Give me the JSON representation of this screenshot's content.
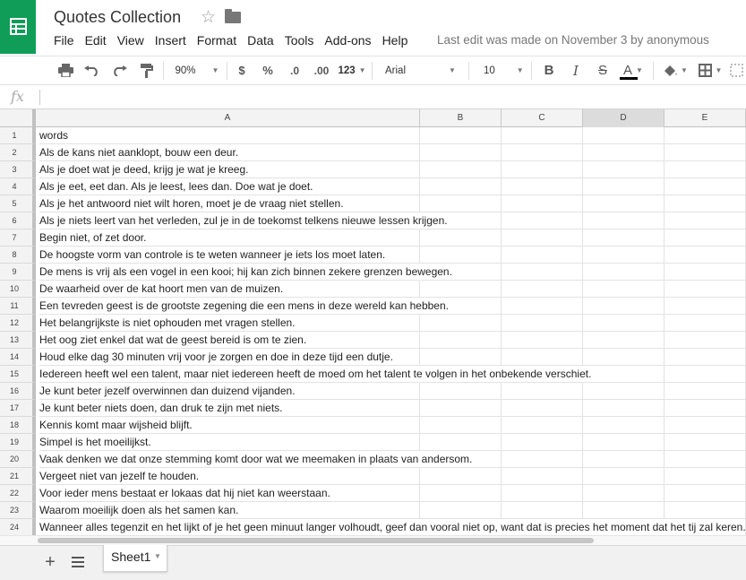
{
  "app": {
    "title": "Quotes Collection",
    "last_edit": "Last edit was made on November 3 by anonymous",
    "brand_color": "#0f9d58"
  },
  "menu": [
    "File",
    "Edit",
    "View",
    "Insert",
    "Format",
    "Data",
    "Tools",
    "Add-ons",
    "Help"
  ],
  "toolbar": {
    "zoom": "90%",
    "currency": "$",
    "percent": "%",
    "decrease_decimals": ".0",
    "increase_decimals": ".00",
    "more_formats": "123",
    "font": "Arial",
    "font_size": "10",
    "bold": "B",
    "italic": "I",
    "strikethrough": "S",
    "text_color_letter": "A",
    "text_color": "#000000",
    "icons": [
      "print-icon",
      "undo-icon",
      "redo-icon",
      "paint-format-icon",
      "fill-color-icon",
      "borders-icon",
      "merge-cells-icon"
    ]
  },
  "formula_bar": {
    "fx": "fx",
    "value": ""
  },
  "columns": [
    "A",
    "B",
    "C",
    "D",
    "E"
  ],
  "selected_column": "D",
  "rows": [
    {
      "n": "1",
      "a": "words"
    },
    {
      "n": "2",
      "a": "Als de kans niet aanklopt, bouw een deur."
    },
    {
      "n": "3",
      "a": "Als je doet wat je deed, krijg je wat je kreeg."
    },
    {
      "n": "4",
      "a": "Als je eet, eet dan. Als je leest, lees dan. Doe wat je doet."
    },
    {
      "n": "5",
      "a": "Als je het antwoord niet wilt horen, moet je de vraag niet stellen."
    },
    {
      "n": "6",
      "a": "Als je niets leert van het verleden, zul je in de toekomst telkens nieuwe lessen krijgen."
    },
    {
      "n": "7",
      "a": "Begin niet, of zet door."
    },
    {
      "n": "8",
      "a": "De hoogste vorm van controle is te weten wanneer je iets los moet laten."
    },
    {
      "n": "9",
      "a": "De mens is vrij als een vogel in een kooi; hij kan zich binnen zekere grenzen bewegen."
    },
    {
      "n": "10",
      "a": "De waarheid over de kat hoort men van de muizen."
    },
    {
      "n": "11",
      "a": "Een tevreden geest is de grootste zegening die een mens in deze wereld kan hebben."
    },
    {
      "n": "12",
      "a": "Het belangrijkste is niet ophouden met vragen stellen."
    },
    {
      "n": "13",
      "a": "Het oog ziet enkel dat wat de geest bereid is om te zien."
    },
    {
      "n": "14",
      "a": "Houd elke dag 30 minuten vrij voor je zorgen en doe in deze tijd een dutje."
    },
    {
      "n": "15",
      "a": "Iedereen heeft wel een talent, maar niet iedereen heeft de moed om het talent te volgen in het onbekende verschiet."
    },
    {
      "n": "16",
      "a": "Je kunt beter jezelf overwinnen dan duizend vijanden."
    },
    {
      "n": "17",
      "a": "Je kunt beter niets doen, dan druk te zijn met niets."
    },
    {
      "n": "18",
      "a": "Kennis komt maar wijsheid blijft."
    },
    {
      "n": "19",
      "a": "Simpel is het moeilijkst."
    },
    {
      "n": "20",
      "a": "Vaak denken we dat onze stemming komt door wat we meemaken in plaats van andersom."
    },
    {
      "n": "21",
      "a": "Vergeet niet van jezelf te houden."
    },
    {
      "n": "22",
      "a": "Voor ieder mens bestaat er lokaas dat hij niet kan weerstaan."
    },
    {
      "n": "23",
      "a": "Waarom moeilijk doen als het samen kan."
    },
    {
      "n": "24",
      "a": "Wanneer alles tegenzit en het lijkt of je het geen minuut langer volhoudt, geef dan vooral niet op, want dat is precies het moment dat het tij zal keren."
    }
  ],
  "sheets": [
    "Sheet1"
  ],
  "active_sheet": "Sheet1"
}
